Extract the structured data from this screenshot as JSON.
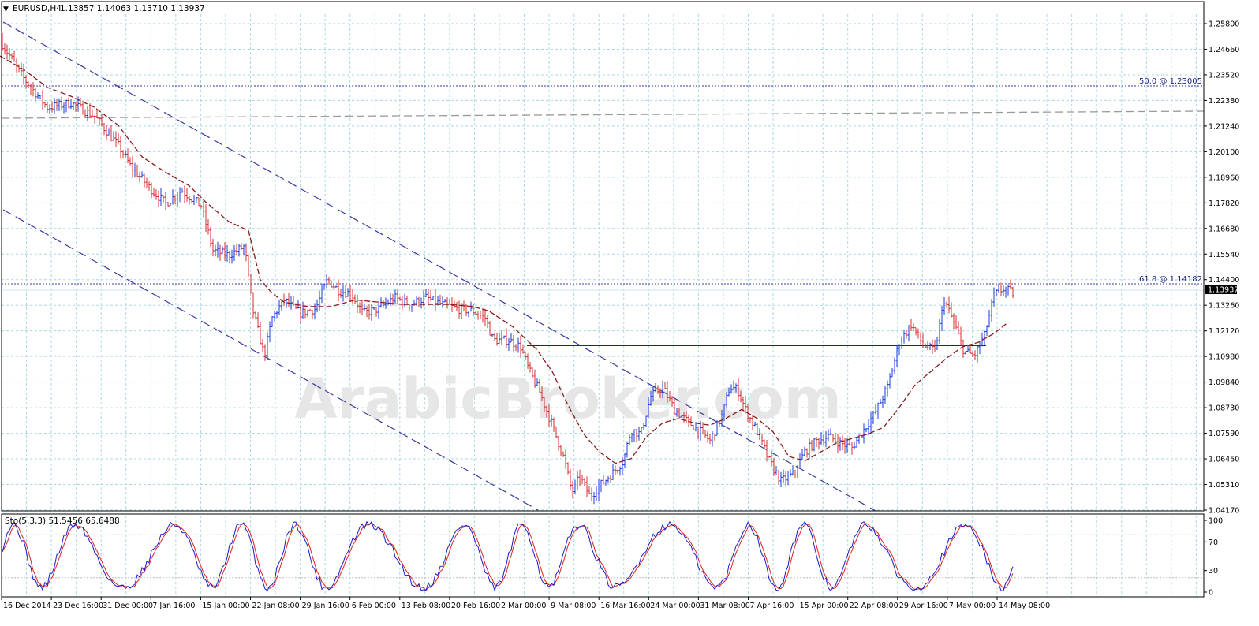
{
  "header": {
    "symbol": "EURUSD,H4",
    "ohlc": "1.13857 1.14063 1.13710 1.13937"
  },
  "stoch_header": {
    "label": "Sto(5,3,3) 51.5456 65.6488"
  },
  "watermark": "ArabicBroker.com",
  "price_axis": {
    "ticks": [
      "1.25800",
      "1.24660",
      "1.23520",
      "1.22380",
      "1.21240",
      "1.20100",
      "1.18960",
      "1.17820",
      "1.16680",
      "1.15540",
      "1.14400",
      "1.13260",
      "1.12120",
      "1.10980",
      "1.09840",
      "1.08730",
      "1.07590",
      "1.06450",
      "1.05310",
      "1.04170"
    ],
    "current": "1.13937"
  },
  "stoch_axis": {
    "ticks": [
      "100",
      "70",
      "30",
      "0"
    ]
  },
  "time_axis": {
    "labels": [
      "16 Dec 2014",
      "23 Dec 16:00",
      "31 Dec 00:00",
      "7 Jan 16:00",
      "15 Jan 00:00",
      "22 Jan 08:00",
      "29 Jan 16:00",
      "6 Feb 00:00",
      "13 Feb 08:00",
      "20 Feb 16:00",
      "2 Mar 00:00",
      "9 Mar 08:00",
      "16 Mar 16:00",
      "24 Mar 00:00",
      "31 Mar 08:00",
      "7 Apr 16:00",
      "15 Apr 00:00",
      "22 Apr 08:00",
      "29 Apr 16:00",
      "7 May 00:00",
      "14 May 08:00"
    ]
  },
  "levels": {
    "fib50": "50.0 @ 1.23005",
    "fib618": "61.8 @ 1.14182"
  },
  "colors": {
    "grid": "#a8d8e0",
    "bar": "#1a3ae0",
    "ma": "#8b1a1a",
    "level": "#1a237e",
    "fib": "#3a3aa0",
    "channel": "#3a3aa0",
    "gray_line": "#9a9a9a",
    "sto_main": "#1a1acc",
    "sto_signal": "#dd2222",
    "current_bg": "#000000"
  },
  "chart_data": {
    "type": "line",
    "title": "EURUSD,H4",
    "ylim": [
      1.0417,
      1.2637
    ],
    "grid": true,
    "x": [
      "16 Dec 2014",
      "23 Dec 16:00",
      "31 Dec 00:00",
      "7 Jan 16:00",
      "15 Jan 00:00",
      "22 Jan 08:00",
      "29 Jan 16:00",
      "6 Feb 00:00",
      "13 Feb 08:00",
      "20 Feb 16:00",
      "2 Mar 00:00",
      "9 Mar 08:00",
      "16 Mar 16:00",
      "24 Mar 00:00",
      "31 Mar 08:00",
      "7 Apr 16:00",
      "15 Apr 00:00",
      "22 Apr 08:00",
      "29 Apr 16:00",
      "7 May 00:00",
      "14 May 08:00"
    ],
    "series": [
      {
        "name": "EURUSD",
        "values": [
          [
            0,
            1.252
          ],
          [
            30,
            1.235
          ],
          [
            60,
            1.222
          ],
          [
            90,
            1.224
          ],
          [
            120,
            1.218
          ],
          [
            150,
            1.205
          ],
          [
            165,
            1.196
          ],
          [
            190,
            1.186
          ],
          [
            210,
            1.179
          ],
          [
            230,
            1.185
          ],
          [
            255,
            1.178
          ],
          [
            270,
            1.158
          ],
          [
            290,
            1.156
          ],
          [
            310,
            1.16
          ],
          [
            320,
            1.132
          ],
          [
            335,
            1.111
          ],
          [
            345,
            1.128
          ],
          [
            360,
            1.136
          ],
          [
            380,
            1.13
          ],
          [
            400,
            1.132
          ],
          [
            415,
            1.145
          ],
          [
            430,
            1.14
          ],
          [
            445,
            1.139
          ],
          [
            460,
            1.13
          ],
          [
            480,
            1.132
          ],
          [
            500,
            1.137
          ],
          [
            520,
            1.134
          ],
          [
            540,
            1.137
          ],
          [
            560,
            1.134
          ],
          [
            580,
            1.132
          ],
          [
            600,
            1.131
          ],
          [
            615,
            1.128
          ],
          [
            625,
            1.118
          ],
          [
            645,
            1.118
          ],
          [
            660,
            1.115
          ],
          [
            670,
            1.105
          ],
          [
            685,
            1.094
          ],
          [
            700,
            1.08
          ],
          [
            715,
            1.065
          ],
          [
            725,
            1.05
          ],
          [
            735,
            1.057
          ],
          [
            748,
            1.048
          ],
          [
            760,
            1.053
          ],
          [
            775,
            1.058
          ],
          [
            790,
            1.064
          ],
          [
            800,
            1.078
          ],
          [
            812,
            1.076
          ],
          [
            825,
            1.093
          ],
          [
            840,
            1.097
          ],
          [
            855,
            1.087
          ],
          [
            870,
            1.082
          ],
          [
            885,
            1.078
          ],
          [
            900,
            1.073
          ],
          [
            915,
            1.084
          ],
          [
            925,
            1.097
          ],
          [
            935,
            1.096
          ],
          [
            945,
            1.087
          ],
          [
            960,
            1.077
          ],
          [
            975,
            1.064
          ],
          [
            990,
            1.055
          ],
          [
            1005,
            1.058
          ],
          [
            1020,
            1.068
          ],
          [
            1035,
            1.073
          ],
          [
            1050,
            1.075
          ],
          [
            1065,
            1.072
          ],
          [
            1080,
            1.07
          ],
          [
            1095,
            1.078
          ],
          [
            1110,
            1.086
          ],
          [
            1125,
            1.097
          ],
          [
            1140,
            1.117
          ],
          [
            1155,
            1.125
          ],
          [
            1170,
            1.116
          ],
          [
            1185,
            1.113
          ],
          [
            1197,
            1.136
          ],
          [
            1210,
            1.125
          ],
          [
            1222,
            1.113
          ],
          [
            1235,
            1.111
          ],
          [
            1248,
            1.12
          ],
          [
            1260,
            1.138
          ],
          [
            1272,
            1.141
          ],
          [
            1285,
            1.139
          ]
        ]
      },
      {
        "name": "MA",
        "values": [
          [
            0,
            1.245
          ],
          [
            30,
            1.239
          ],
          [
            60,
            1.231
          ],
          [
            90,
            1.227
          ],
          [
            120,
            1.222
          ],
          [
            150,
            1.214
          ],
          [
            180,
            1.2
          ],
          [
            210,
            1.193
          ],
          [
            240,
            1.187
          ],
          [
            260,
            1.18
          ],
          [
            290,
            1.171
          ],
          [
            315,
            1.167
          ],
          [
            330,
            1.145
          ],
          [
            345,
            1.139
          ],
          [
            360,
            1.135
          ],
          [
            390,
            1.133
          ],
          [
            420,
            1.133
          ],
          [
            450,
            1.136
          ],
          [
            480,
            1.135
          ],
          [
            510,
            1.134
          ],
          [
            540,
            1.134
          ],
          [
            570,
            1.134
          ],
          [
            600,
            1.133
          ],
          [
            620,
            1.131
          ],
          [
            650,
            1.124
          ],
          [
            680,
            1.114
          ],
          [
            700,
            1.104
          ],
          [
            720,
            1.089
          ],
          [
            740,
            1.076
          ],
          [
            760,
            1.068
          ],
          [
            780,
            1.063
          ],
          [
            800,
            1.065
          ],
          [
            820,
            1.075
          ],
          [
            840,
            1.081
          ],
          [
            860,
            1.083
          ],
          [
            880,
            1.081
          ],
          [
            900,
            1.08
          ],
          [
            920,
            1.083
          ],
          [
            940,
            1.087
          ],
          [
            960,
            1.083
          ],
          [
            980,
            1.077
          ],
          [
            1000,
            1.066
          ],
          [
            1020,
            1.064
          ],
          [
            1040,
            1.068
          ],
          [
            1060,
            1.072
          ],
          [
            1080,
            1.074
          ],
          [
            1100,
            1.076
          ],
          [
            1120,
            1.079
          ],
          [
            1140,
            1.088
          ],
          [
            1160,
            1.098
          ],
          [
            1180,
            1.104
          ],
          [
            1200,
            1.11
          ],
          [
            1220,
            1.115
          ],
          [
            1240,
            1.117
          ],
          [
            1260,
            1.121
          ],
          [
            1278,
            1.126
          ]
        ]
      }
    ]
  }
}
